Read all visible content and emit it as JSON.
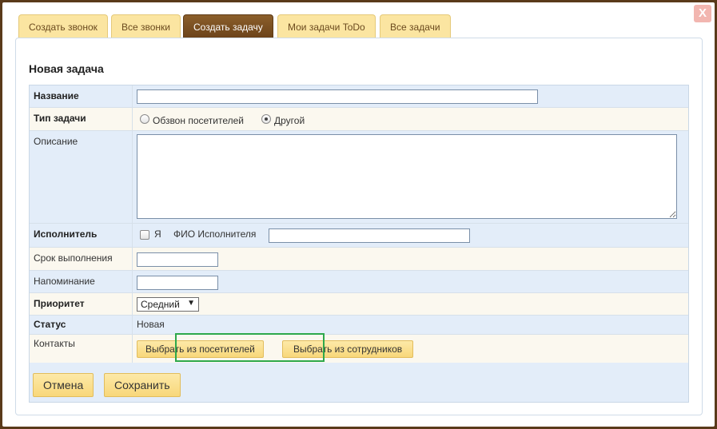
{
  "window": {
    "close_label": "X"
  },
  "tabs": [
    {
      "label": "Создать звонок"
    },
    {
      "label": "Все звонки"
    },
    {
      "label": "Создать задачу",
      "active": true
    },
    {
      "label": "Мои задачи ToDo"
    },
    {
      "label": "Все задачи"
    }
  ],
  "form": {
    "title": "Новая задача",
    "name": {
      "label": "Название",
      "value": ""
    },
    "type": {
      "label": "Тип задачи",
      "options": [
        "Обзвон посетителей",
        "Другой"
      ],
      "selected": "Другой"
    },
    "description": {
      "label": "Описание",
      "value": ""
    },
    "assignee": {
      "label": "Исполнитель",
      "me_label": "Я",
      "me_checked": false,
      "fio_label": "ФИО Исполнителя",
      "fio_value": ""
    },
    "deadline": {
      "label": "Срок выполнения",
      "value": ""
    },
    "reminder": {
      "label": "Напоминание",
      "value": ""
    },
    "priority": {
      "label": "Приоритет",
      "value": "Средний",
      "arrow": "▼"
    },
    "status": {
      "label": "Статус",
      "value": "Новая"
    },
    "contacts": {
      "label": "Контакты",
      "pick_visitors": "Выбрать из посетителей",
      "pick_employees": "Выбрать из сотрудников"
    },
    "cancel_label": "Отмена",
    "save_label": "Сохранить"
  },
  "colors": {
    "tab_active": "#7a4f22",
    "tab_inactive": "#fbe5a1",
    "row_blue": "#e3edf9",
    "row_cream": "#fbf8ef",
    "highlight": "#2ea84b"
  }
}
